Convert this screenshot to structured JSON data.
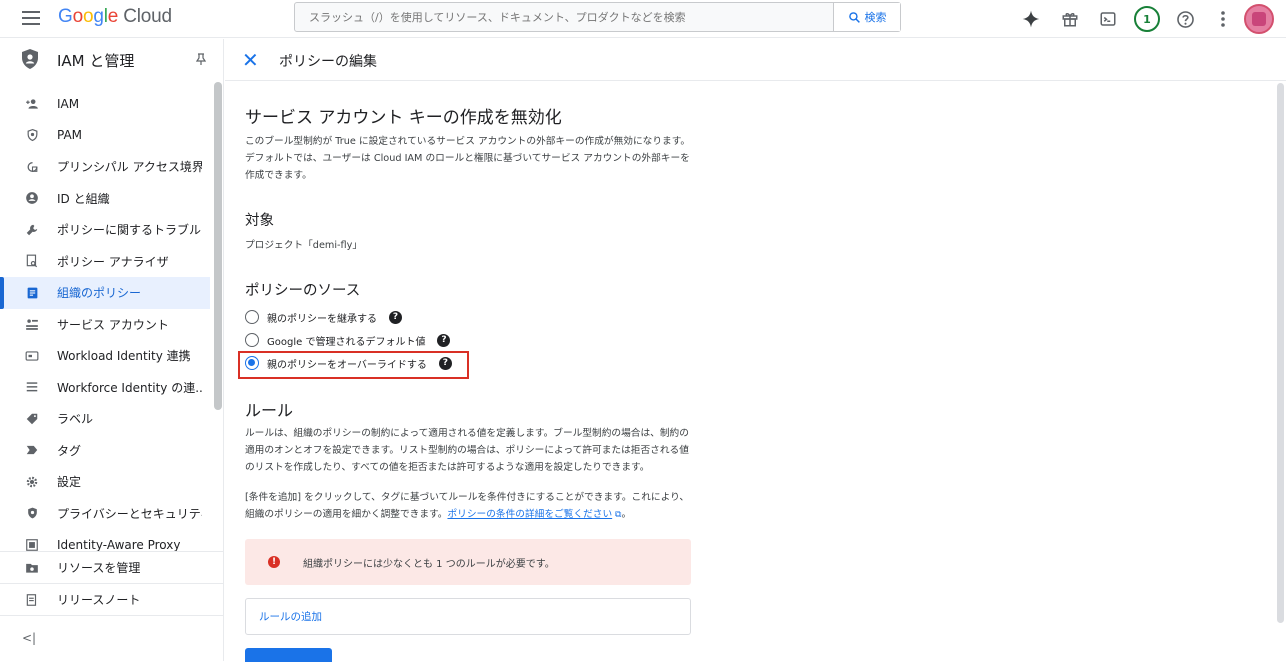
{
  "topbar": {
    "logo": {
      "g1": "G",
      "g2": "o",
      "g3": "o",
      "g4": "g",
      "g5": "l",
      "g6": "e",
      "cloud": "Cloud"
    },
    "search_placeholder": "スラッシュ（/）を使用してリソース、ドキュメント、プロダクトなどを検索",
    "search_button": "検索",
    "notification_count": "1"
  },
  "sidebar": {
    "title": "IAM と管理",
    "items": [
      {
        "label": "IAM",
        "icon": "add-person-icon"
      },
      {
        "label": "PAM",
        "icon": "shield-lock-icon"
      },
      {
        "label": "プリンシパル アクセス境界",
        "icon": "account-box-icon"
      },
      {
        "label": "ID と組織",
        "icon": "person-circle-icon"
      },
      {
        "label": "ポリシーに関するトラブルシ...",
        "icon": "wrench-icon"
      },
      {
        "label": "ポリシー アナライザ",
        "icon": "document-search-icon"
      },
      {
        "label": "組織のポリシー",
        "icon": "list-document-icon",
        "active": true
      },
      {
        "label": "サービス アカウント",
        "icon": "service-account-icon"
      },
      {
        "label": "Workload Identity 連携",
        "icon": "id-card-icon"
      },
      {
        "label": "Workforce Identity の連...",
        "icon": "list-icon"
      },
      {
        "label": "ラベル",
        "icon": "tag-icon"
      },
      {
        "label": "タグ",
        "icon": "chevron-tag-icon"
      },
      {
        "label": "設定",
        "icon": "gear-icon"
      },
      {
        "label": "プライバシーとセキュリティ",
        "icon": "shield-icon"
      },
      {
        "label": "Identity-Aware Proxy",
        "icon": "proxy-icon"
      }
    ],
    "bottom_items": [
      {
        "label": "リソースを管理",
        "icon": "folder-gear-icon"
      },
      {
        "label": "リリースノート",
        "icon": "notes-icon"
      }
    ],
    "collapse": "<|"
  },
  "header": {
    "title": "ポリシーの編集"
  },
  "content": {
    "title": "サービス アカウント キーの作成を無効化",
    "description": "このブール型制約が True に設定されているサービス アカウントの外部キーの作成が無効になります。デフォルトでは、ユーザーは Cloud IAM のロールと権限に基づいてサービス アカウントの外部キーを作成できます。",
    "target_heading": "対象",
    "target_value": "プロジェクト「demi-fly」",
    "source_heading": "ポリシーのソース",
    "source_options": [
      {
        "label": "親のポリシーを継承する",
        "checked": false
      },
      {
        "label": "Google で管理されるデフォルト値",
        "checked": false
      },
      {
        "label": "親のポリシーをオーバーライドする",
        "checked": true
      }
    ],
    "rules_heading": "ルール",
    "rules_description": "ルールは、組織のポリシーの制約によって適用される値を定義します。ブール型制約の場合は、制約の適用のオンとオフを設定できます。リスト型制約の場合は、ポリシーによって許可または拒否される値のリストを作成したり、すべての値を拒否または許可するような適用を設定したりできます。",
    "conditions_text": "[条件を追加] をクリックして、タグに基づいてルールを条件付きにすることができます。これにより、組織のポリシーの適用を細かく調整できます。",
    "conditions_link": "ポリシーの条件の詳細をご覧ください",
    "conditions_end": "。",
    "error_text": "組織ポリシーには少なくとも 1 つのルールが必要です。",
    "add_rule": "ルールの追加"
  }
}
